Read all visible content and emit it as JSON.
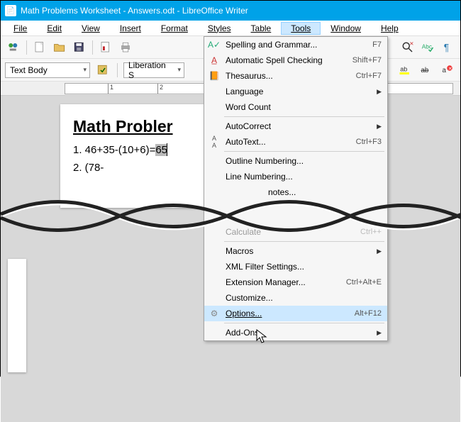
{
  "window": {
    "title": "Math Problems Worksheet - Answers.odt - LibreOffice Writer"
  },
  "menubar": {
    "file": "File",
    "edit": "Edit",
    "view": "View",
    "insert": "Insert",
    "format": "Format",
    "styles": "Styles",
    "table": "Table",
    "tools": "Tools",
    "window": "Window",
    "help": "Help"
  },
  "toolbar2": {
    "style_combo": "Text Body",
    "font_combo": "Liberation S"
  },
  "document": {
    "heading": "Math Probler",
    "line1_prefix": "1. 46+35-(10+6)=",
    "line1_sel": "65",
    "line2": "2. (78-"
  },
  "ruler": {
    "n1": "1",
    "n2": "2"
  },
  "tools_menu": {
    "spelling": "Spelling and Grammar...",
    "spelling_sc": "F7",
    "auto_spell": "Automatic Spell Checking",
    "auto_spell_sc": "Shift+F7",
    "thesaurus": "Thesaurus...",
    "thesaurus_sc": "Ctrl+F7",
    "language": "Language",
    "word_count": "Word Count",
    "autocorrect": "AutoCorrect",
    "autotext": "AutoText...",
    "autotext_sc": "Ctrl+F3",
    "outline_num": "Outline Numbering...",
    "line_num": "Line Numbering...",
    "footnotes": "notes...",
    "calculate": "Calculate",
    "calculate_sc": "Ctrl++",
    "macros": "Macros",
    "xml_filter": "XML Filter Settings...",
    "ext_mgr": "Extension Manager...",
    "ext_mgr_sc": "Ctrl+Alt+E",
    "customize": "Customize...",
    "options": "Options...",
    "options_sc": "Alt+F12",
    "addons": "Add-Ons"
  }
}
